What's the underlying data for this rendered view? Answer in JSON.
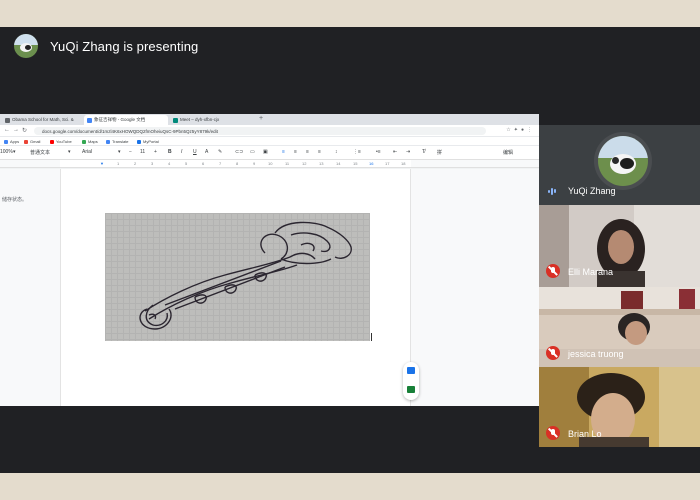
{
  "presenter": {
    "text": "YuQi Zhang is presenting"
  },
  "browser": {
    "tabs": [
      {
        "label": "Obama School for Math, Sci. &",
        "color": "#5f6368"
      },
      {
        "label": "象征吉祥物 - Google 文档",
        "color": "#4285f4"
      },
      {
        "label": "Meet – dyh-xfbn-cjx",
        "color": "#00897b"
      }
    ],
    "new_tab": "+",
    "url": "docs.google.com/document/d/1mzl4K6xHOWQDQ2fmOheiuQsC-9Pbn5Qz5yY879k/edit",
    "bookmarks": [
      "Apps",
      "Gmail",
      "YouTube",
      "Maps",
      "Translate",
      "MyPortal"
    ],
    "toolbar": {
      "zoom": "100%",
      "style": "普通文本",
      "font": "Arial",
      "size": "11",
      "edit_mode": "编辑"
    },
    "ruler_numbers": [
      "1",
      "2",
      "3",
      "4",
      "5",
      "6",
      "7",
      "8",
      "9",
      "10",
      "11",
      "12",
      "13",
      "14",
      "15",
      "16",
      "17",
      "18"
    ],
    "doc_side_text": "储存状态。"
  },
  "participants": [
    {
      "name": "YuQi Zhang",
      "muted": false
    },
    {
      "name": "Elli Marana",
      "muted": true
    },
    {
      "name": "jessica truong",
      "muted": true
    },
    {
      "name": "Brian Lo",
      "muted": true
    }
  ],
  "icons": {
    "mic_muted": "mic-off-icon",
    "mic_active": "speaking-indicator-icon"
  },
  "colors": {
    "meet_bg": "#202124",
    "muted_red": "#d93025",
    "speaking_blue": "#8ab4f8"
  }
}
